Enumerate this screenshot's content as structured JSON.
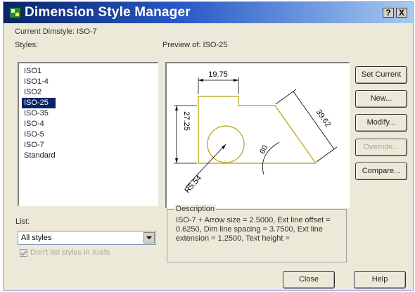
{
  "window": {
    "title": "Dimension Style Manager",
    "help_button": "?",
    "close_button": "X"
  },
  "current_dimstyle_label": "Current Dimstyle: ISO-7",
  "styles": {
    "label": "Styles:",
    "items": [
      "ISO1",
      "ISO1-4",
      "ISO2",
      "ISO-25",
      "ISO-35",
      "ISO-4",
      "ISO-5",
      "ISO-7",
      "Standard"
    ],
    "selected": "ISO-25"
  },
  "preview": {
    "label": "Preview of: ISO-25",
    "dims": {
      "top": "19.75",
      "left": "27.25",
      "right": "39.62",
      "angle": "60",
      "radius": "R5.54"
    },
    "colors": {
      "geometry": "#b8a000",
      "dimension": "#000000"
    }
  },
  "buttons": {
    "set_current": "Set Current",
    "new": "New...",
    "modify": "Modify...",
    "override": "Override...",
    "compare": "Compare...",
    "close": "Close",
    "help": "Help"
  },
  "list": {
    "label": "List:",
    "selected": "All styles"
  },
  "checkbox": {
    "label": "Don't list styles in Xrefs",
    "checked": true,
    "disabled": true
  },
  "description": {
    "label": "Description",
    "text": "ISO-7 + Arrow size = 2.5000, Ext line offset = 0.6250, Dim line spacing = 3.7500, Ext line extension = 1.2500, Text height ="
  }
}
